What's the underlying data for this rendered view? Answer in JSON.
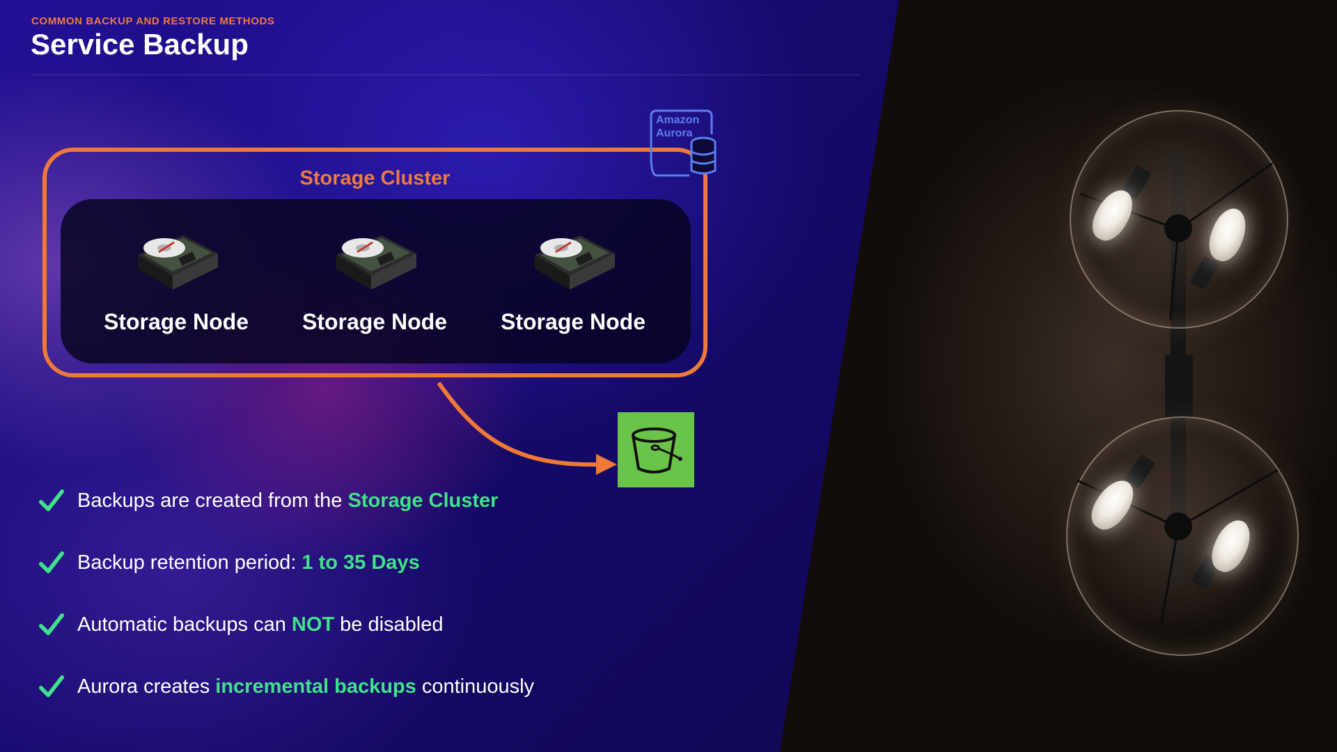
{
  "header": {
    "subtitle": "COMMON BACKUP AND RESTORE METHODS",
    "title": "Service Backup"
  },
  "diagram": {
    "cluster_title": "Storage Cluster",
    "nodes": [
      {
        "label": "Storage Node"
      },
      {
        "label": "Storage Node"
      },
      {
        "label": "Storage Node"
      }
    ],
    "aurora_label_line1": "Amazon",
    "aurora_label_line2": "Aurora",
    "bucket_icon": "s3-bucket-icon",
    "colors": {
      "accent": "#ef7a38",
      "highlight": "#3fe38a",
      "aurora": "#5d7ef0",
      "bucket": "#6bc44a"
    }
  },
  "bullets": [
    {
      "pre": "Backups are created from the ",
      "hl": "Storage Cluster",
      "post": ""
    },
    {
      "pre": "Backup retention period: ",
      "hl": "1 to 35 Days",
      "post": ""
    },
    {
      "pre": "Automatic backups can ",
      "hl": "NOT",
      "post": " be disabled"
    },
    {
      "pre": "Aurora creates ",
      "hl": "incremental backups",
      "post": " continuously"
    }
  ]
}
